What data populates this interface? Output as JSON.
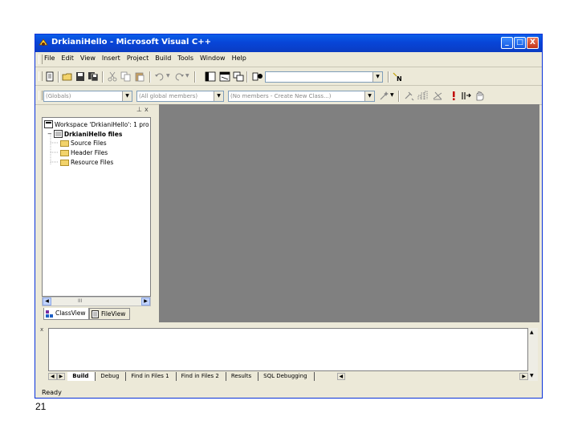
{
  "window": {
    "title": "DrkianiHello - Microsoft Visual C++",
    "controls": {
      "minimize": "_",
      "maximize": "□",
      "close": "X"
    }
  },
  "menu": {
    "items": [
      "File",
      "Edit",
      "View",
      "Insert",
      "Project",
      "Build",
      "Tools",
      "Window",
      "Help"
    ]
  },
  "toolbar1": {
    "icons": [
      "new-text-file-icon",
      "open-icon",
      "save-icon",
      "save-all-icon",
      "cut-icon",
      "copy-icon",
      "paste-icon",
      "undo-icon",
      "redo-icon",
      "workspace-icon",
      "output-icon",
      "window-list-icon",
      "find-in-files-icon",
      "search-combo-icon"
    ],
    "find_value": ""
  },
  "toolbar2": {
    "class_combo": "(Globals)",
    "filter_combo": "(All global members)",
    "members_combo": "(No members - Create New Class...)",
    "icons": [
      "wizard-action-icon",
      "compile-icon",
      "build-icon",
      "stop-build-icon",
      "execute-icon",
      "go-icon",
      "breakpoint-icon"
    ]
  },
  "workspace": {
    "header_controls": [
      "⊥",
      "x"
    ],
    "tree": [
      {
        "label": "Workspace 'DrkianiHello': 1 pro",
        "level": 0,
        "icon": "workspace-icon"
      },
      {
        "label": "DrkianiHello files",
        "level": 1,
        "icon": "project-icon",
        "bold": true
      },
      {
        "label": "Source Files",
        "level": 2,
        "icon": "folder-icon"
      },
      {
        "label": "Header Files",
        "level": 2,
        "icon": "folder-icon"
      },
      {
        "label": "Resource Files",
        "level": 2,
        "icon": "folder-icon"
      }
    ],
    "scroll_thumb": "III",
    "tabs": [
      "ClassView",
      "FileView"
    ]
  },
  "output": {
    "tabs": [
      "Build",
      "Debug",
      "Find in Files 1",
      "Find in Files 2",
      "Results",
      "SQL Debugging"
    ]
  },
  "status": {
    "text": "Ready"
  },
  "slide": {
    "number": "21"
  }
}
